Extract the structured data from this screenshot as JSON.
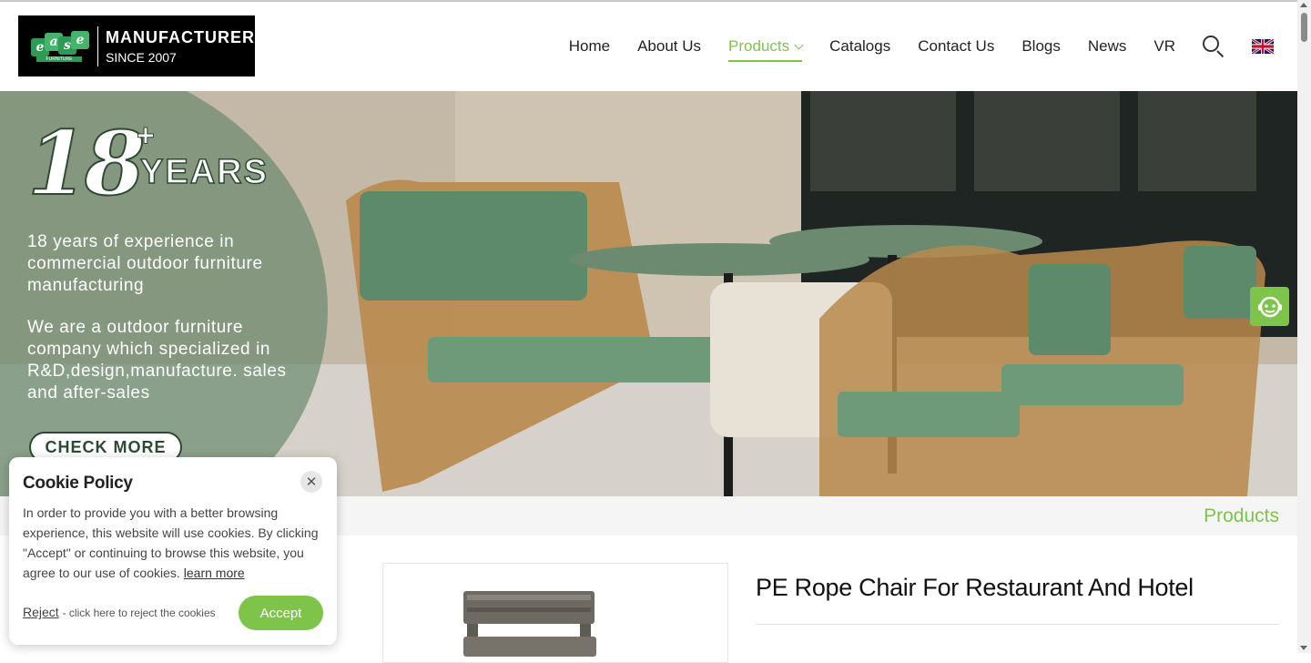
{
  "logo": {
    "line1": "MANUFACTURER",
    "line2": "SINCE 2007",
    "mark": [
      "e",
      "a",
      "s",
      "e"
    ],
    "mark_sub": "FURNITURE"
  },
  "nav": {
    "items": [
      {
        "label": "Home"
      },
      {
        "label": "About Us"
      },
      {
        "label": "Products",
        "active": true
      },
      {
        "label": "Catalogs"
      },
      {
        "label": "Contact Us"
      },
      {
        "label": "Blogs"
      },
      {
        "label": "News"
      },
      {
        "label": "VR"
      }
    ],
    "search_icon": "search-icon",
    "language_icon": "uk-flag-icon"
  },
  "hero": {
    "number": "18",
    "plus": "+",
    "years": "YEARS",
    "paragraph1": "18 years of experience in commercial outdoor furniture manufacturing",
    "paragraph2": "We are a outdoor furniture company which specialized in R&D,design,manufacture. sales and after-sales",
    "button": "CHECK MORE"
  },
  "section": {
    "title": "Products"
  },
  "product": {
    "title": "PE Rope Chair For Restaurant And Hotel"
  },
  "cookie": {
    "title": "Cookie Policy",
    "close_icon": "close-icon",
    "body": "In order to provide you with a better browsing experience, this website will use cookies. By clicking \"Accept\" or continuing to browse this website, you agree to our use of cookies.",
    "learn_more": "learn more",
    "reject": "Reject",
    "reject_note": "- click here to reject the cookies",
    "accept": "Accept"
  },
  "colors": {
    "accent": "#7ec34a",
    "hero_green": "#2d4a33"
  }
}
